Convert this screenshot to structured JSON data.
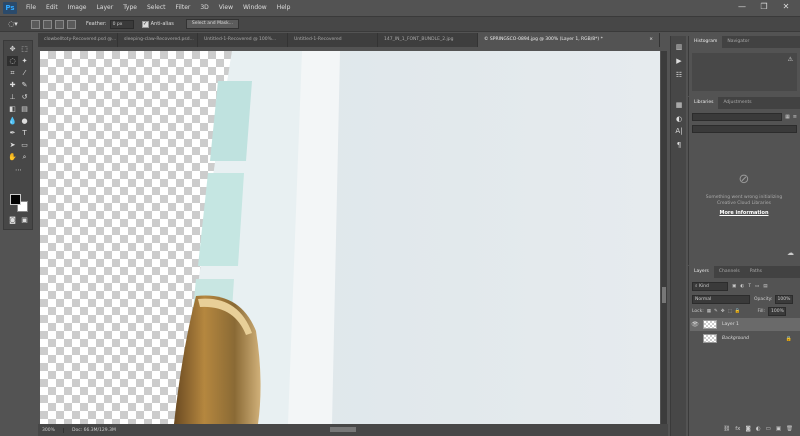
{
  "app": {
    "logo": "Ps"
  },
  "menu": [
    "File",
    "Edit",
    "Image",
    "Layer",
    "Type",
    "Select",
    "Filter",
    "3D",
    "View",
    "Window",
    "Help"
  ],
  "window_controls": {
    "minimize": "—",
    "restore": "❐",
    "close": "✕"
  },
  "options": {
    "feather_label": "Feather:",
    "feather_value": "0 px",
    "antialias_label": "Anti-alias",
    "antialias_checked": "✓",
    "select_mask_label": "Select and Mask..."
  },
  "tabs": [
    {
      "label": "clowbelltoty-Recovered.psd @..."
    },
    {
      "label": "sleeping-claw-Recovered.psd..."
    },
    {
      "label": "Untitled-1-Recovered @ 100%..."
    },
    {
      "label": "Untitled-1-Recovered"
    },
    {
      "label": "147_IN_1_FONT_BUNDLE_2.jpg"
    },
    {
      "label": "© SPRINGSCO-0894.jpg @ 300% (Layer 1, RGB/8*) *",
      "close": "×"
    }
  ],
  "status": {
    "zoom": "300%",
    "doc": "Doc: 66.3M/129.3M"
  },
  "histogram": {
    "tab": "Histogram",
    "tab2": "Navigator",
    "warning": "⚠"
  },
  "libraries": {
    "tab": "Libraries",
    "tab2": "Adjustments",
    "error_line1": "Something went wrong initializing",
    "error_line2": "Creative Cloud Libraries",
    "more_info": "More information"
  },
  "layers": {
    "tabs": [
      "Layers",
      "Channels",
      "Paths"
    ],
    "kind": "Kind",
    "blend_mode": "Normal",
    "opacity_label": "Opacity:",
    "opacity_value": "100%",
    "lock_label": "Lock:",
    "fill_label": "Fill:",
    "fill_value": "100%",
    "items": [
      {
        "name": "Layer 1"
      },
      {
        "name": "Background"
      }
    ],
    "footer": "fx"
  },
  "colors": {
    "accent": "#31a8ff",
    "panel": "#535353",
    "dark": "#474747"
  }
}
